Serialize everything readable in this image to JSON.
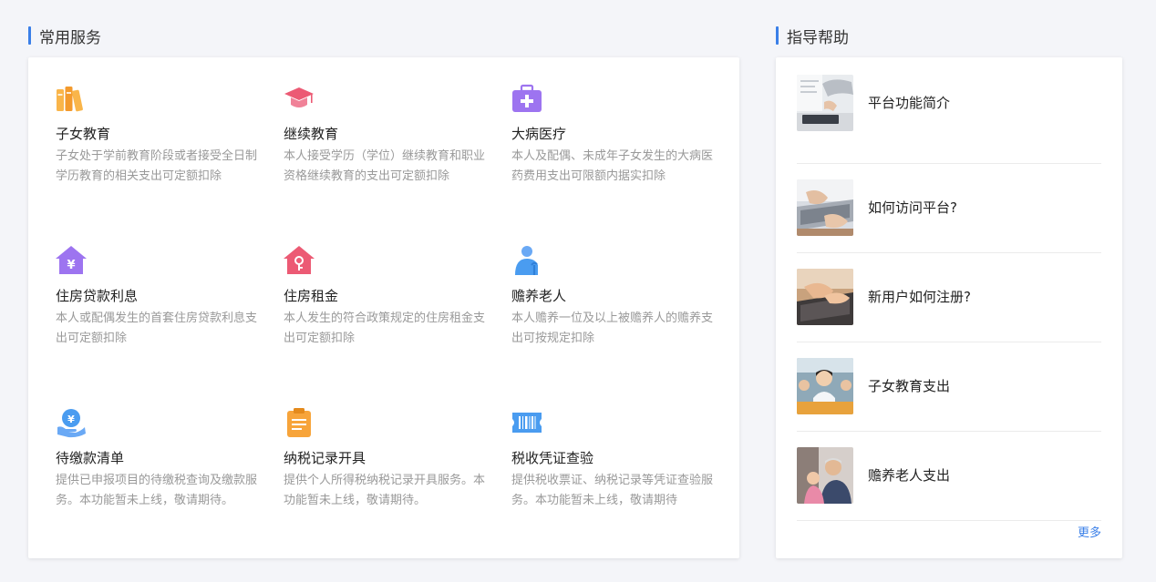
{
  "services": {
    "title": "常用服务",
    "items": [
      {
        "name": "子女教育",
        "desc": "子女处于学前教育阶段或者接受全日制学历教育的相关支出可定额扣除",
        "icon": "books-icon"
      },
      {
        "name": "继续教育",
        "desc": "本人接受学历（学位）继续教育和职业资格继续教育的支出可定额扣除",
        "icon": "graduation-cap-icon"
      },
      {
        "name": "大病医疗",
        "desc": "本人及配偶、未成年子女发生的大病医药费用支出可限额内据实扣除",
        "icon": "medical-kit-icon"
      },
      {
        "name": "住房贷款利息",
        "desc": "本人或配偶发生的首套住房贷款利息支出可定额扣除",
        "icon": "house-yuan-icon"
      },
      {
        "name": "住房租金",
        "desc": "本人发生的符合政策规定的住房租金支出可定额扣除",
        "icon": "house-key-icon"
      },
      {
        "name": "赡养老人",
        "desc": "本人赡养一位及以上被赡养人的赡养支出可按规定扣除",
        "icon": "elder-person-icon"
      },
      {
        "name": "待缴款清单",
        "desc": "提供已申报项目的待缴税查询及缴款服务。本功能暂未上线，敬请期待。",
        "icon": "payment-hand-icon"
      },
      {
        "name": "纳税记录开具",
        "desc": "提供个人所得税纳税记录开具服务。本功能暂未上线，敬请期待。",
        "icon": "clipboard-icon"
      },
      {
        "name": "税收凭证查验",
        "desc": "提供税收票证、纳税记录等凭证查验服务。本功能暂未上线，敬请期待",
        "icon": "barcode-ticket-icon"
      }
    ]
  },
  "help": {
    "title": "指导帮助",
    "items": [
      {
        "label": "平台功能简介",
        "thumb": "office-desk-photo"
      },
      {
        "label": "如何访问平台?",
        "thumb": "laptop-hands-photo"
      },
      {
        "label": "新用户如何注册?",
        "thumb": "typing-keyboard-photo"
      },
      {
        "label": "子女教育支出",
        "thumb": "classroom-children-photo"
      },
      {
        "label": "赡养老人支出",
        "thumb": "elderly-family-photo"
      }
    ],
    "more": "更多"
  },
  "colors": {
    "accent": "#3a7fe8",
    "orange": "#f7a43a",
    "pink": "#ec5a74",
    "purple": "#9d74f0",
    "blue": "#4a9cf0"
  }
}
